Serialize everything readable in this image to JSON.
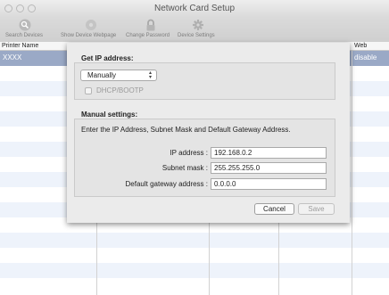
{
  "window": {
    "title": "Network Card Setup"
  },
  "toolbar": {
    "items": [
      {
        "label": "Search Devices",
        "icon": "magnifier-icon"
      },
      {
        "label": "Show Device Webpage",
        "icon": "globe-icon"
      },
      {
        "label": "Change Password",
        "icon": "lock-icon"
      },
      {
        "label": "Device Settings",
        "icon": "gear-icon"
      }
    ]
  },
  "table": {
    "columns": [
      "Printer Name",
      "Web"
    ],
    "selected_row": {
      "name": "XXXX",
      "web": "disable"
    }
  },
  "sheet": {
    "ip_group_title": "Get IP address:",
    "ip_mode": "Manually",
    "dhcp_label": "DHCP/BOOTP",
    "manual_title": "Manual settings:",
    "instruction": "Enter the IP Address, Subnet Mask and Default Gateway Address.",
    "fields": [
      {
        "label": "IP address :",
        "value": "192.168.0.2"
      },
      {
        "label": "Subnet mask :",
        "value": "255.255.255.0"
      },
      {
        "label": "Default gateway address :",
        "value": "0.0.0.0"
      }
    ],
    "cancel_label": "Cancel",
    "save_label": "Save"
  }
}
